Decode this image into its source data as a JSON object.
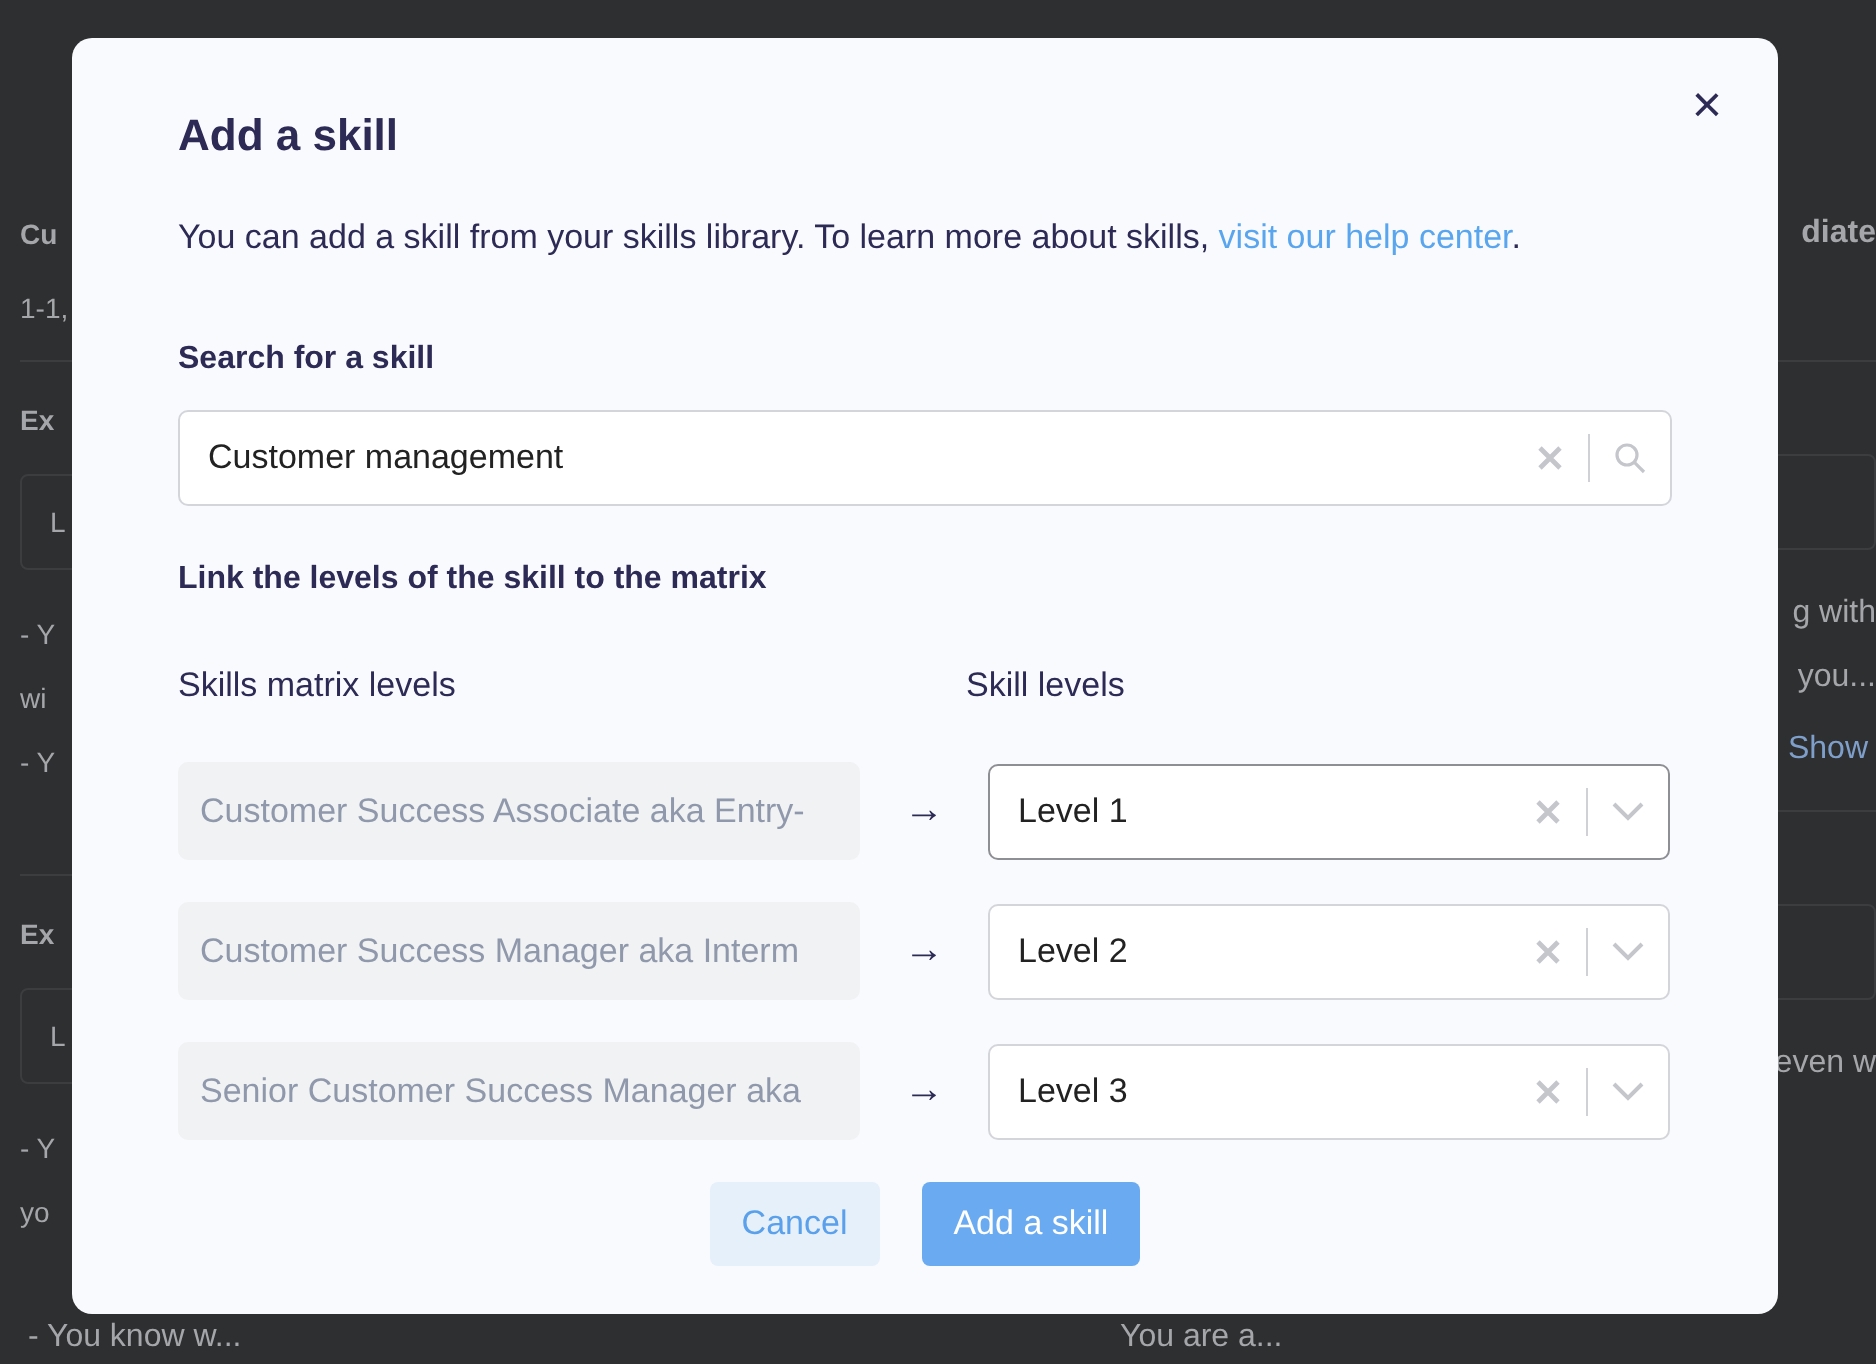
{
  "background": {
    "left_column": [
      {
        "kind": "heading",
        "text": "Cu"
      },
      {
        "kind": "text",
        "text": "1-1,"
      },
      {
        "kind": "divider"
      },
      {
        "kind": "heading",
        "text": "Ex"
      },
      {
        "kind": "box",
        "text": "L"
      },
      {
        "kind": "text",
        "text": "- Y"
      },
      {
        "kind": "text",
        "text": "wi"
      },
      {
        "kind": "text",
        "text": "- Y"
      },
      {
        "kind": "gap"
      },
      {
        "kind": "divider"
      },
      {
        "kind": "heading",
        "text": "Ex"
      },
      {
        "kind": "box",
        "text": "L"
      },
      {
        "kind": "text",
        "text": "- Y"
      },
      {
        "kind": "text",
        "text": "yo"
      }
    ],
    "right_column": [
      {
        "kind": "heading",
        "text": "diate"
      },
      {
        "kind": "blank"
      },
      {
        "kind": "divider"
      },
      {
        "kind": "blank"
      },
      {
        "kind": "box"
      },
      {
        "kind": "text",
        "text": "g with"
      },
      {
        "kind": "text",
        "text": "you..."
      },
      {
        "kind": "link",
        "text": "Show"
      },
      {
        "kind": "divider"
      },
      {
        "kind": "blank"
      },
      {
        "kind": "box"
      },
      {
        "kind": "text",
        "text": "even w"
      },
      {
        "kind": "blank"
      }
    ],
    "bottom_left": "- You know w...",
    "bottom_right": "You are a..."
  },
  "dialog": {
    "title": "Add a skill",
    "close": "×",
    "intro": "You can add a skill from your skills library. To learn more about skills, ",
    "intro_link": "visit our help center",
    "intro_end": ".",
    "search_label": "Search for a skill",
    "search_value": "Customer management",
    "link_label": "Link the levels of the skill to the matrix",
    "column_headers": [
      "Skills matrix levels",
      "Skill levels"
    ],
    "rows": [
      {
        "matrix_level": "Customer Success Associate aka Entry-",
        "arrow": "→",
        "skill_level": "Level 1",
        "focused": true
      },
      {
        "matrix_level": "Customer Success Manager aka Interm",
        "arrow": "→",
        "skill_level": "Level 2",
        "focused": false
      },
      {
        "matrix_level": "Senior Customer Success Manager aka",
        "arrow": "→",
        "skill_level": "Level 3",
        "focused": false
      }
    ],
    "buttons": [
      {
        "kind": "secondary",
        "label": "Cancel"
      },
      {
        "kind": "primary",
        "label": "Add a skill"
      }
    ]
  }
}
